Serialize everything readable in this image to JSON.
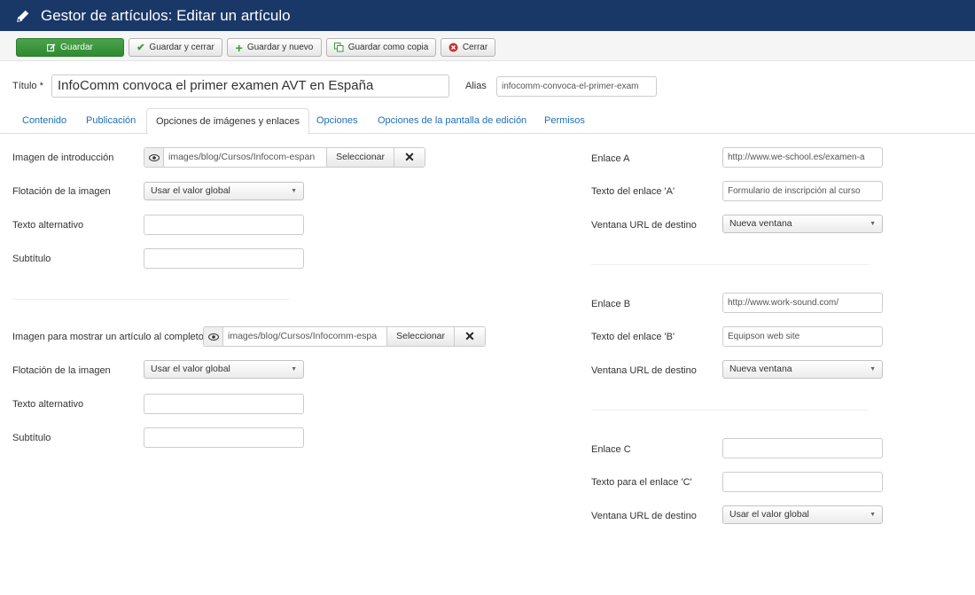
{
  "header": {
    "title": "Gestor de artículos: Editar un artículo"
  },
  "toolbar": {
    "save": "Guardar",
    "save_close": "Guardar y cerrar",
    "save_new": "Guardar y nuevo",
    "save_copy": "Guardar como copia",
    "close": "Cerrar"
  },
  "article": {
    "title_label": "Título *",
    "title_value": "InfoComm convoca el primer examen AVT en España",
    "alias_label": "Alias",
    "alias_value": "infocomm-convoca-el-primer-exam"
  },
  "tabs": [
    "Contenido",
    "Publicación",
    "Opciones de imágenes y enlaces",
    "Opciones",
    "Opciones de la pantalla de edición",
    "Permisos"
  ],
  "images": {
    "intro": {
      "label": "Imagen de introducción",
      "path": "images/blog/Cursos/Infocom-espan",
      "select": "Seleccionar",
      "float_label": "Flotación de la imagen",
      "float_value": "Usar el valor global",
      "alt_label": "Texto alternativo",
      "alt_value": "",
      "caption_label": "Subtítulo",
      "caption_value": ""
    },
    "full": {
      "label": "Imagen para mostrar un artículo al completo",
      "path": "images/blog/Cursos/Infocomm-espa",
      "select": "Seleccionar",
      "float_label": "Flotación de la imagen",
      "float_value": "Usar el valor global",
      "alt_label": "Texto alternativo",
      "alt_value": "",
      "caption_label": "Subtítulo",
      "caption_value": ""
    }
  },
  "links": {
    "a": {
      "link_label": "Enlace A",
      "link_value": "http://www.we-school.es/examen-a",
      "text_label": "Texto del enlace 'A'",
      "text_value": "Formulario de inscripción al curso",
      "target_label": "Ventana URL de destino",
      "target_value": "Nueva ventana"
    },
    "b": {
      "link_label": "Enlace B",
      "link_value": "http://www.work-sound.com/",
      "text_label": "Texto del enlace 'B'",
      "text_value": "Equipson web site",
      "target_label": "Ventana URL de destino",
      "target_value": "Nueva ventana"
    },
    "c": {
      "link_label": "Enlace C",
      "link_value": "",
      "text_label": "Texto para el enlace 'C'",
      "text_value": "",
      "target_label": "Ventana URL de destino",
      "target_value": "Usar el valor global"
    }
  },
  "colors": {
    "header_bg": "#1a3867",
    "save_green": "#3a9a3d",
    "link_blue": "#1f6fb5",
    "close_red": "#c9302c"
  }
}
